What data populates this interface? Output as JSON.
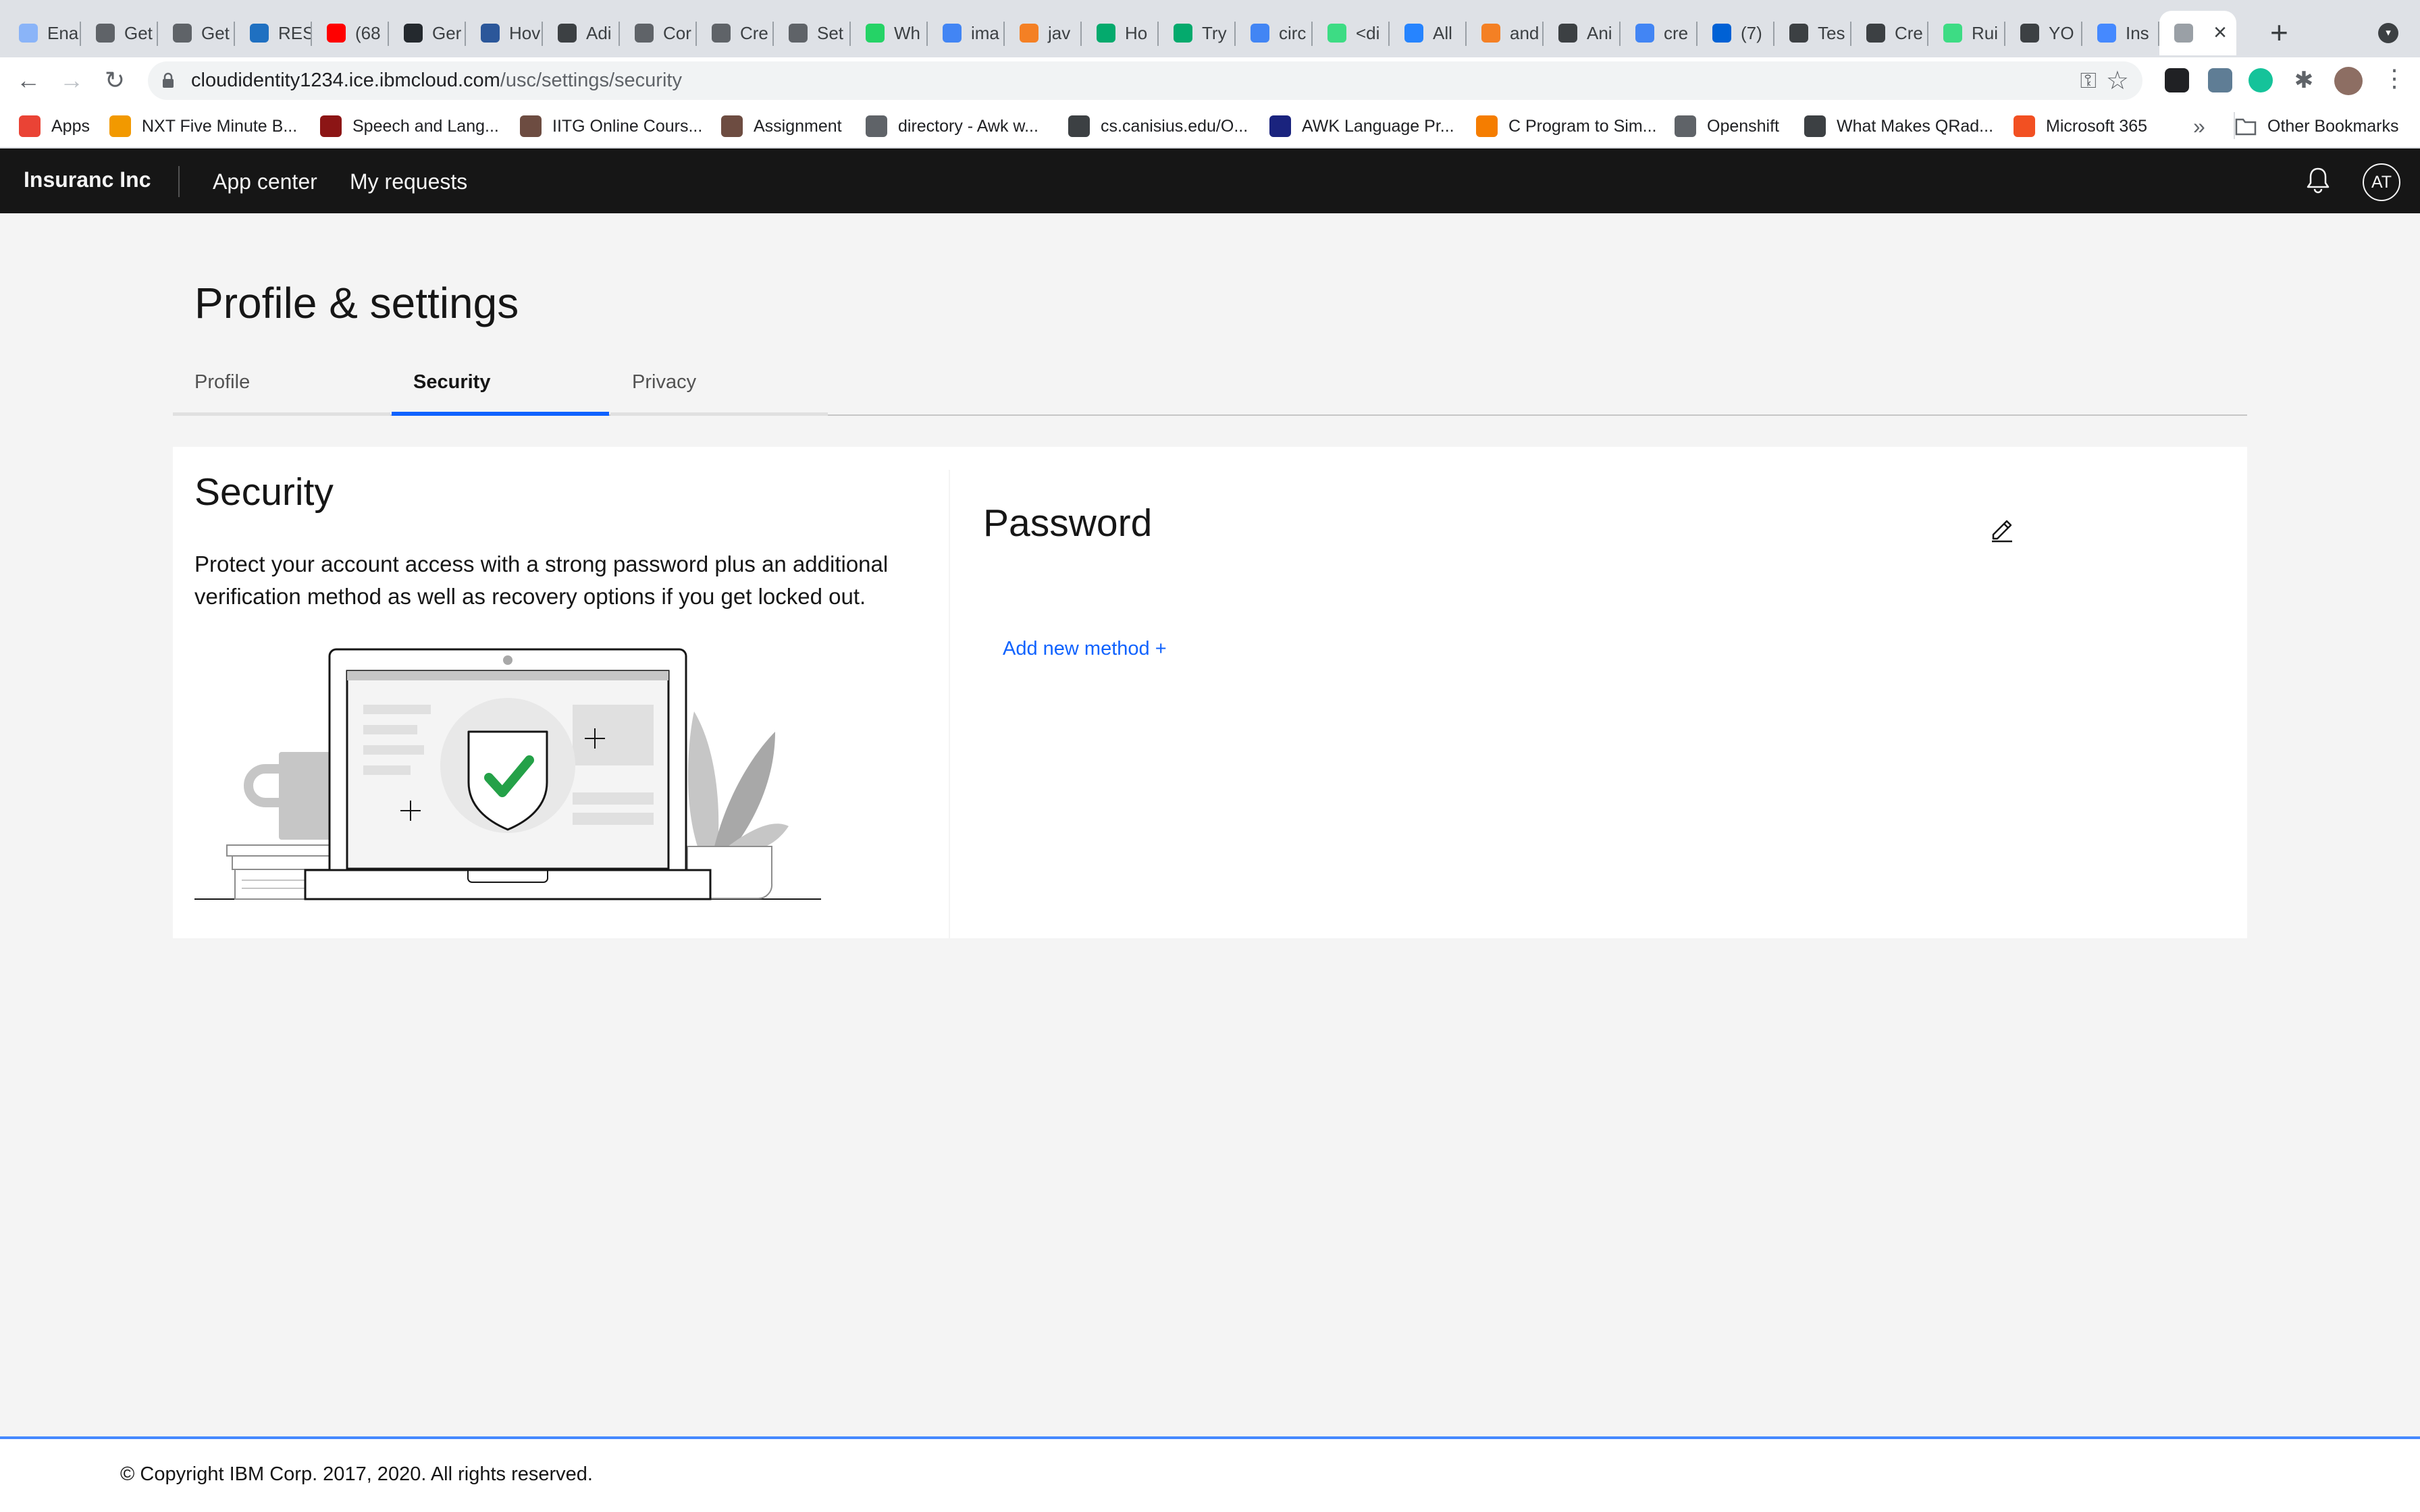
{
  "browser": {
    "tabs": [
      {
        "title": "Ena",
        "icon": "cloud-icon",
        "color": "#8ab4f8"
      },
      {
        "title": "Get",
        "icon": "bike-icon",
        "color": "#5f6368"
      },
      {
        "title": "Get",
        "icon": "bike-icon",
        "color": "#5f6368"
      },
      {
        "title": "RES",
        "icon": "ibm-icon",
        "color": "#1f70c1"
      },
      {
        "title": "(68",
        "icon": "youtube-icon",
        "color": "#ff0000"
      },
      {
        "title": "Ger",
        "icon": "github-icon",
        "color": "#24292e"
      },
      {
        "title": "Hov",
        "icon": "m-icon",
        "color": "#2b579a"
      },
      {
        "title": "Adi",
        "icon": "globe-icon",
        "color": "#3c4043"
      },
      {
        "title": "Cor",
        "icon": "bike-icon",
        "color": "#5f6368"
      },
      {
        "title": "Cre",
        "icon": "bike-icon",
        "color": "#5f6368"
      },
      {
        "title": "Set",
        "icon": "bike-icon",
        "color": "#5f6368"
      },
      {
        "title": "Wh",
        "icon": "whatsapp-icon",
        "color": "#25d366"
      },
      {
        "title": "ima",
        "icon": "google-icon",
        "color": "#4285f4"
      },
      {
        "title": "jav",
        "icon": "stackoverflow-icon",
        "color": "#f48024"
      },
      {
        "title": "Ho",
        "icon": "w3-icon",
        "color": "#04aa6d"
      },
      {
        "title": "Try",
        "icon": "w3-icon",
        "color": "#04aa6d"
      },
      {
        "title": "circ",
        "icon": "google-icon",
        "color": "#4285f4"
      },
      {
        "title": "<di",
        "icon": "android-icon",
        "color": "#3ddc84"
      },
      {
        "title": "All",
        "icon": "jira-icon",
        "color": "#2684ff"
      },
      {
        "title": "and",
        "icon": "stackoverflow-icon",
        "color": "#f48024"
      },
      {
        "title": "Ani",
        "icon": "diamond-icon",
        "color": "#3c4043"
      },
      {
        "title": "cre",
        "icon": "google-icon",
        "color": "#4285f4"
      },
      {
        "title": "(7)",
        "icon": "box-icon",
        "color": "#0061d5"
      },
      {
        "title": "Tes",
        "icon": "doc-icon",
        "color": "#3c4043"
      },
      {
        "title": "Cre",
        "icon": "doc-icon",
        "color": "#3c4043"
      },
      {
        "title": "Rui",
        "icon": "android-icon",
        "color": "#3ddc84"
      },
      {
        "title": "YO",
        "icon": "y-icon",
        "color": "#3c4043"
      },
      {
        "title": "Ins",
        "icon": "verify-icon",
        "color": "#4589ff"
      },
      {
        "title": "",
        "icon": "shield-icon",
        "color": "#9aa0a6",
        "active": true
      }
    ],
    "address": {
      "host": "cloudidentity1234.ice.ibmcloud.com",
      "path": "/usc/settings/security"
    },
    "bookmarks": [
      {
        "label": "Apps",
        "icon": "apps-grid-icon",
        "color": "#ea4335"
      },
      {
        "label": "NXT Five Minute B...",
        "icon": "nxt-icon",
        "color": "#f29900"
      },
      {
        "label": "Speech and Lang...",
        "icon": "stanford-icon",
        "color": "#8c1515"
      },
      {
        "label": "IITG Online Cours...",
        "icon": "iitg-icon",
        "color": "#6d4c41"
      },
      {
        "label": "Assignment",
        "icon": "iitg-icon",
        "color": "#6d4c41"
      },
      {
        "label": "directory - Awk w...",
        "icon": "ul-icon",
        "color": "#5f6368"
      },
      {
        "label": "cs.canisius.edu/O...",
        "icon": "globe-icon",
        "color": "#3c4043"
      },
      {
        "label": "AWK Language Pr...",
        "icon": "fu-icon",
        "color": "#1a237e"
      },
      {
        "label": "C Program to Sim...",
        "icon": "blogger-icon",
        "color": "#f57d00"
      },
      {
        "label": "Openshift",
        "icon": "folder-icon",
        "color": "#5f6368"
      },
      {
        "label": "What Makes QRad...",
        "icon": "qradar-icon",
        "color": "#3c4043"
      },
      {
        "label": "Microsoft 365",
        "icon": "microsoft-icon",
        "color": "#f25022"
      }
    ],
    "more_bookmarks": "»",
    "other_bookmarks": "Other Bookmarks"
  },
  "app": {
    "brand": "Insuranc Inc",
    "nav": [
      "App center",
      "My requests"
    ],
    "avatar_initials": "AT"
  },
  "page": {
    "title": "Profile & settings",
    "tabs": [
      "Profile",
      "Security",
      "Privacy"
    ],
    "active_tab": "Security",
    "security": {
      "title": "Security",
      "description": "Protect your account access with a strong password plus an additional verification method as well as recovery options if you get locked out."
    },
    "password": {
      "title": "Password",
      "add_method": "Add new method +"
    }
  },
  "footer": {
    "copyright": "© Copyright IBM Corp. 2017, 2020. All rights reserved."
  },
  "colors": {
    "accent": "#0f62fe",
    "header_bg": "#161616",
    "page_bg": "#f4f4f4",
    "success": "#24a148"
  }
}
